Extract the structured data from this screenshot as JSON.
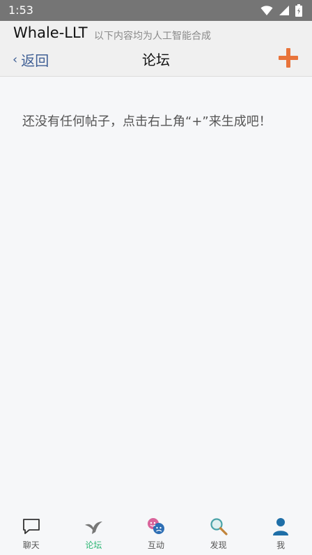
{
  "status_bar": {
    "time": "1:53"
  },
  "app_header": {
    "title": "Whale-LLT",
    "subtitle": "以下内容均为人工智能合成"
  },
  "nav": {
    "back_label": "返回",
    "title": "论坛"
  },
  "main": {
    "empty_message": "还没有任何帖子，点击右上角“+”来生成吧！"
  },
  "tabs": [
    {
      "label": "聊天",
      "icon": "chat-bubble-icon"
    },
    {
      "label": "论坛",
      "icon": "forum-bird-icon"
    },
    {
      "label": "互动",
      "icon": "drama-masks-icon"
    },
    {
      "label": "发现",
      "icon": "magnifier-icon"
    },
    {
      "label": "我",
      "icon": "person-icon"
    }
  ],
  "colors": {
    "accent_orange": "#e8743b",
    "active_tab": "#2bb673",
    "back_link": "#3f5f95"
  }
}
